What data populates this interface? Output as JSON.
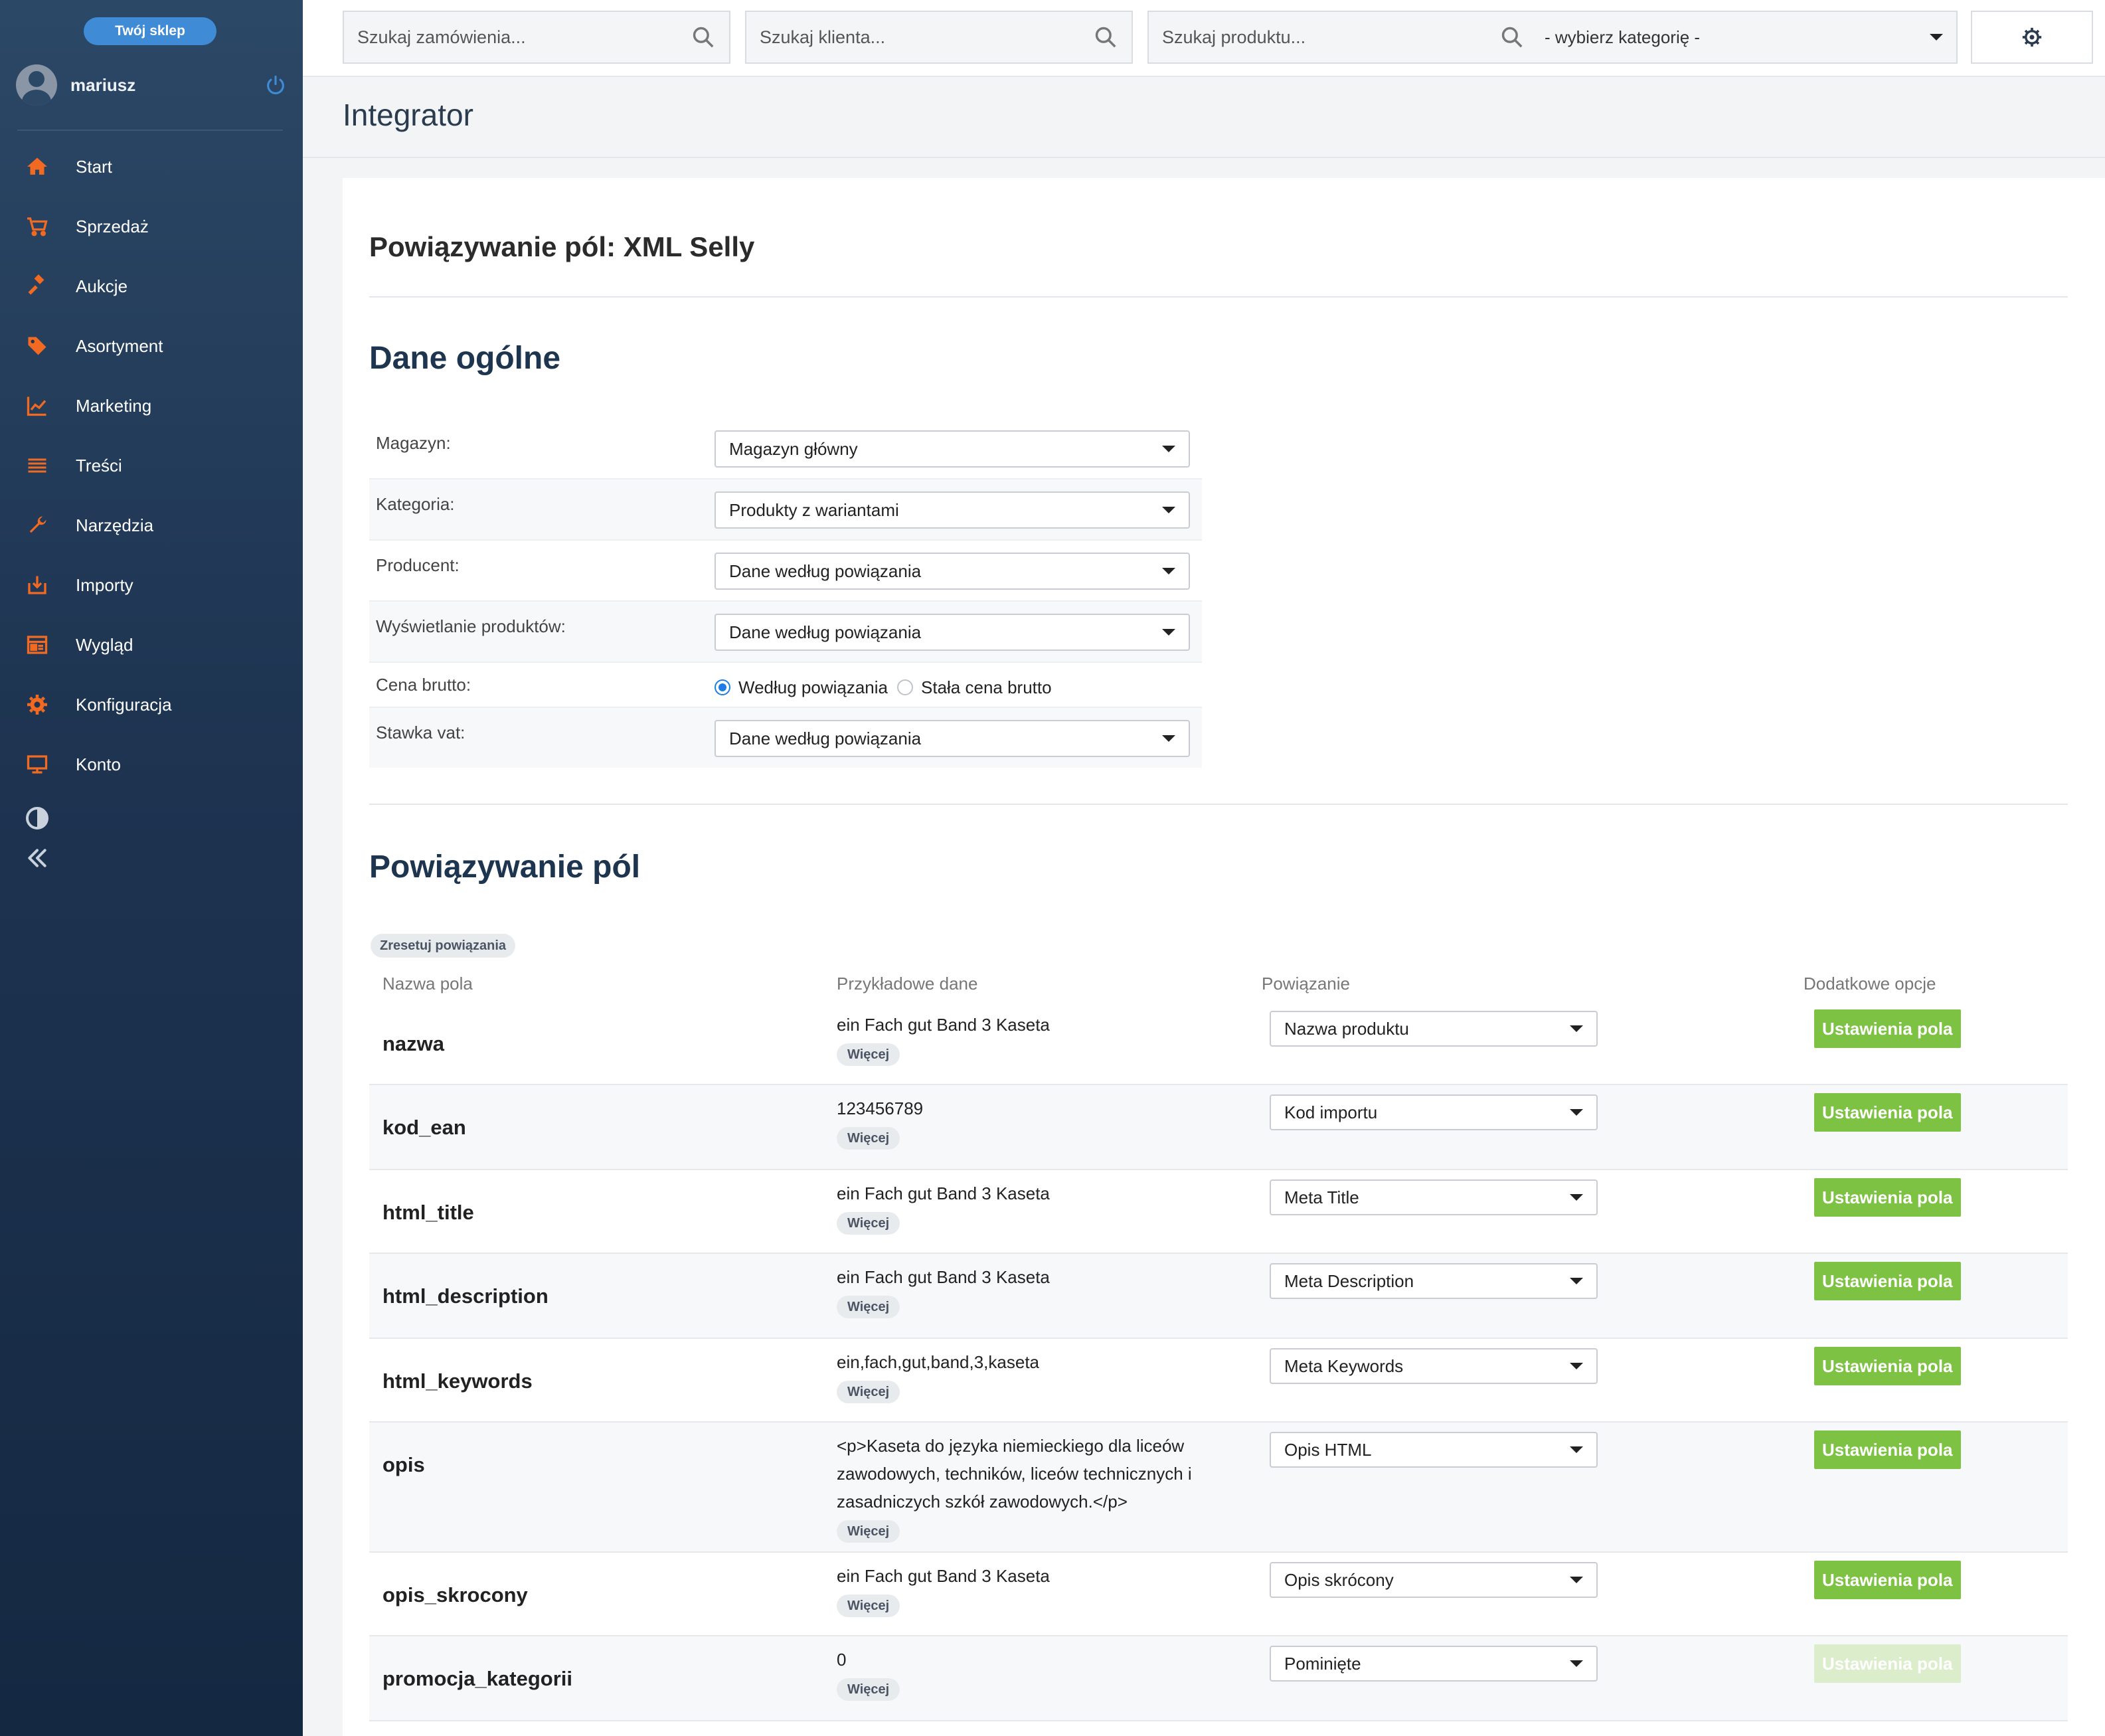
{
  "sidebar": {
    "shop_badge": "Twój sklep",
    "username": "mariusz",
    "items": [
      {
        "label": "Start",
        "icon": "home-icon"
      },
      {
        "label": "Sprzedaż",
        "icon": "cart-icon"
      },
      {
        "label": "Aukcje",
        "icon": "gavel-icon"
      },
      {
        "label": "Asortyment",
        "icon": "tag-icon"
      },
      {
        "label": "Marketing",
        "icon": "chart-icon"
      },
      {
        "label": "Treści",
        "icon": "lines-icon"
      },
      {
        "label": "Narzędzia",
        "icon": "wrench-icon"
      },
      {
        "label": "Importy",
        "icon": "import-icon"
      },
      {
        "label": "Wygląd",
        "icon": "layout-icon"
      },
      {
        "label": "Konfiguracja",
        "icon": "gear-icon"
      },
      {
        "label": "Konto",
        "icon": "monitor-icon"
      }
    ],
    "accent_color": "#f26a21"
  },
  "topbar": {
    "orders_placeholder": "Szukaj zamówienia...",
    "clients_placeholder": "Szukaj klienta...",
    "products_placeholder": "Szukaj produktu...",
    "category_select": "- wybierz kategorię -"
  },
  "page": {
    "title": "Integrator",
    "card_title": "Powiązywanie pól: XML Selly"
  },
  "general": {
    "title": "Dane ogólne",
    "magazyn_label": "Magazyn:",
    "magazyn_value": "Magazyn główny",
    "kategoria_label": "Kategoria:",
    "kategoria_value": "Produkty z wariantami",
    "producent_label": "Producent:",
    "producent_value": "Dane według powiązania",
    "wyswietlanie_label": "Wyświetlanie produktów:",
    "wyswietlanie_value": "Dane według powiązania",
    "cena_label": "Cena brutto:",
    "cena_option1": "Według powiązania",
    "cena_option2": "Stała cena brutto",
    "cena_selected": "Według powiązania",
    "vat_label": "Stawka vat:",
    "vat_value": "Dane według powiązania"
  },
  "mapping": {
    "title": "Powiązywanie pól",
    "reset_label": "Zresetuj powiązania",
    "col_name": "Nazwa pola",
    "col_sample": "Przykładowe dane",
    "col_binding": "Powiązanie",
    "col_options": "Dodatkowe opcje",
    "more_label": "Więcej",
    "settings_label": "Ustawienia pola",
    "rows": [
      {
        "name": "nazwa",
        "sample": "ein Fach gut Band 3 Kaseta",
        "binding": "Nazwa produktu",
        "enabled": true
      },
      {
        "name": "kod_ean",
        "sample": "123456789",
        "binding": "Kod importu",
        "enabled": true
      },
      {
        "name": "html_title",
        "sample": "ein Fach gut Band 3 Kaseta",
        "binding": "Meta Title",
        "enabled": true
      },
      {
        "name": "html_description",
        "sample": "ein Fach gut Band 3 Kaseta",
        "binding": "Meta Description",
        "enabled": true
      },
      {
        "name": "html_keywords",
        "sample": "ein,fach,gut,band,3,kaseta",
        "binding": "Meta Keywords",
        "enabled": true
      },
      {
        "name": "opis",
        "sample": "<p>Kaseta do języka niemieckiego dla liceów zawodowych, techników, liceów technicznych i zasadniczych szkół zawodowych.</p>",
        "binding": "Opis HTML",
        "enabled": true
      },
      {
        "name": "opis_skrocony",
        "sample": "ein Fach gut Band 3 Kaseta",
        "binding": "Opis skrócony",
        "enabled": true
      },
      {
        "name": "promocja_kategorii",
        "sample": "0",
        "binding": "Pominięte",
        "enabled": false
      }
    ]
  }
}
